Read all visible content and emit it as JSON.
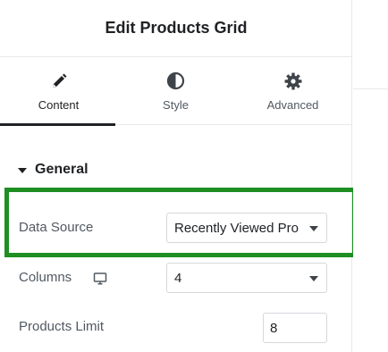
{
  "header": {
    "title": "Edit Products Grid"
  },
  "tabs": [
    {
      "label": "Content",
      "icon": "pencil-icon",
      "active": true
    },
    {
      "label": "Style",
      "icon": "contrast-icon",
      "active": false
    },
    {
      "label": "Advanced",
      "icon": "gear-icon",
      "active": false
    }
  ],
  "section": {
    "title": "General",
    "expanded": true
  },
  "fields": {
    "data_source": {
      "label": "Data Source",
      "value": "Recently Viewed Pro"
    },
    "columns": {
      "label": "Columns",
      "value": "4",
      "device_icon": "desktop-icon"
    },
    "products_limit": {
      "label": "Products Limit",
      "value": "8"
    }
  },
  "colors": {
    "highlight": "#1e8f22",
    "text": "#1f2124",
    "muted": "#515962"
  }
}
